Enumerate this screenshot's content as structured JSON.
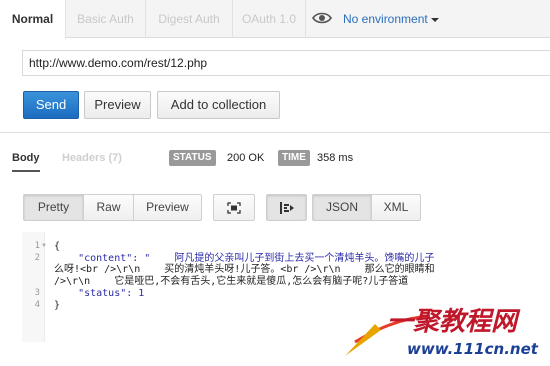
{
  "auth_tabs": [
    {
      "label": "Normal"
    },
    {
      "label": "Basic Auth"
    },
    {
      "label": "Digest Auth"
    },
    {
      "label": "OAuth 1.0"
    }
  ],
  "environment": {
    "icon": "eye-icon",
    "label": "No environment"
  },
  "request": {
    "url": "http://www.demo.com/rest/12.php",
    "send_label": "Send",
    "preview_label": "Preview",
    "add_collection_label": "Add to collection"
  },
  "response": {
    "body_tab": "Body",
    "headers_tab": "Headers (7)",
    "status_badge": "STATUS",
    "status_value": "200 OK",
    "time_badge": "TIME",
    "time_value": "358 ms"
  },
  "view_toolbar": {
    "pretty_label": "Pretty",
    "raw_label": "Raw",
    "preview_label": "Preview",
    "json_label": "JSON",
    "xml_label": "XML"
  },
  "code": {
    "line_numbers": [
      "1",
      "2",
      "",
      "",
      "3",
      "4"
    ],
    "lines": [
      "{",
      "    \"content\": \"    阿凡提的父亲叫儿子到街上去买一个清炖羊头。馋嘴的儿子",
      "么呀!<br />\\r\\n    买的清炖羊头呀!儿子答。<br />\\r\\n    那么它的眼睛和",
      "/>\\r\\n    它是哑巴,不会有舌头,它生来就是傻瓜,怎么会有脑子呢?儿子答道",
      "    \"status\": 1",
      "}"
    ]
  },
  "watermark": {
    "text": "一聚教程网",
    "url": "www.111cn.net"
  },
  "colors": {
    "accent": "#1c6cc0",
    "link": "#2a6ebb",
    "badge": "#999999"
  }
}
